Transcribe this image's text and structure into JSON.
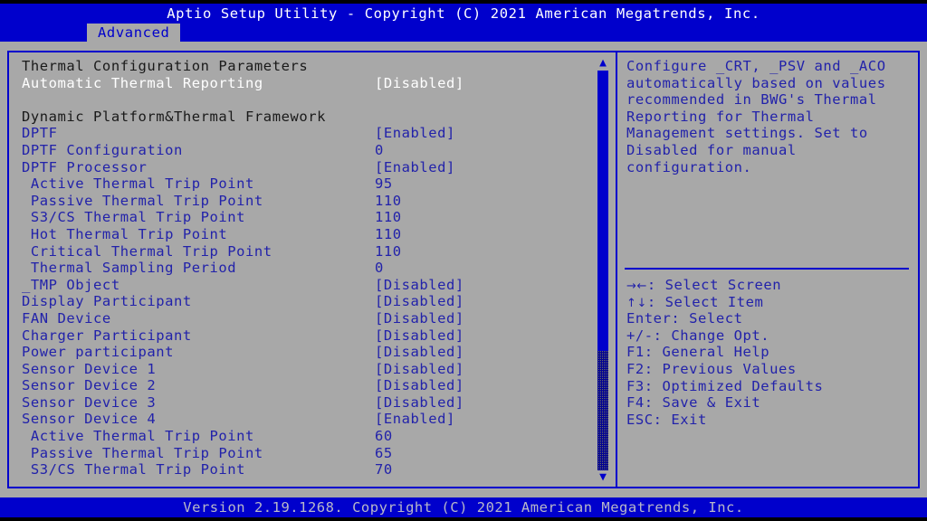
{
  "header": {
    "title": "Aptio Setup Utility - Copyright (C) 2021 American Megatrends, Inc.",
    "active_tab": "Advanced"
  },
  "menu": {
    "rows": [
      {
        "label": "Thermal Configuration Parameters",
        "value": "",
        "style": "head"
      },
      {
        "label": "Automatic Thermal Reporting",
        "value": "[Disabled]",
        "style": "dim"
      },
      {
        "label": "",
        "value": "",
        "style": "blank"
      },
      {
        "label": "Dynamic Platform&Thermal Framework",
        "value": "",
        "style": "head"
      },
      {
        "label": "DPTF",
        "value": "[Enabled]",
        "style": "opt"
      },
      {
        "label": "DPTF Configuration",
        "value": "0",
        "style": "opt"
      },
      {
        "label": "DPTF Processor",
        "value": "[Enabled]",
        "style": "opt"
      },
      {
        "label": " Active Thermal Trip Point",
        "value": "95",
        "style": "opt"
      },
      {
        "label": " Passive Thermal Trip Point",
        "value": "110",
        "style": "opt"
      },
      {
        "label": " S3/CS Thermal Trip Point",
        "value": "110",
        "style": "opt"
      },
      {
        "label": " Hot Thermal Trip Point",
        "value": "110",
        "style": "opt"
      },
      {
        "label": " Critical Thermal Trip Point",
        "value": "110",
        "style": "opt"
      },
      {
        "label": " Thermal Sampling Period",
        "value": "0",
        "style": "opt"
      },
      {
        "label": "_TMP Object",
        "value": "[Disabled]",
        "style": "opt"
      },
      {
        "label": "Display Participant",
        "value": "[Disabled]",
        "style": "opt"
      },
      {
        "label": "FAN Device",
        "value": "[Disabled]",
        "style": "opt"
      },
      {
        "label": "Charger Participant",
        "value": "[Disabled]",
        "style": "opt"
      },
      {
        "label": "Power participant",
        "value": "[Disabled]",
        "style": "opt"
      },
      {
        "label": "Sensor Device 1",
        "value": "[Disabled]",
        "style": "opt"
      },
      {
        "label": "Sensor Device 2",
        "value": "[Disabled]",
        "style": "opt"
      },
      {
        "label": "Sensor Device 3",
        "value": "[Disabled]",
        "style": "opt"
      },
      {
        "label": "Sensor Device 4",
        "value": "[Enabled]",
        "style": "opt"
      },
      {
        "label": " Active Thermal Trip Point",
        "value": "60",
        "style": "opt"
      },
      {
        "label": " Passive Thermal Trip Point",
        "value": "65",
        "style": "opt"
      },
      {
        "label": " S3/CS Thermal Trip Point",
        "value": "70",
        "style": "opt"
      }
    ]
  },
  "scrollbar": {
    "up_arrow": "▲",
    "down_arrow": "▼"
  },
  "help": {
    "description_lines": [
      "Configure _CRT, _PSV and _ACO",
      "automatically based on values",
      "recommended in BWG's Thermal",
      "Reporting for Thermal",
      "Management settings. Set to",
      "Disabled for manual",
      "configuration."
    ],
    "keys": [
      {
        "glyph": "→←",
        "text": ": Select Screen"
      },
      {
        "glyph": "↑↓",
        "text": ": Select Item"
      },
      {
        "glyph": "",
        "text": "Enter: Select"
      },
      {
        "glyph": "",
        "text": "+/-: Change Opt."
      },
      {
        "glyph": "",
        "text": "F1: General Help"
      },
      {
        "glyph": "",
        "text": "F2: Previous Values"
      },
      {
        "glyph": "",
        "text": "F3: Optimized Defaults"
      },
      {
        "glyph": "",
        "text": "F4: Save & Exit"
      },
      {
        "glyph": "",
        "text": "ESC: Exit"
      }
    ]
  },
  "footer": {
    "text": "Version 2.19.1268. Copyright (C) 2021 American Megatrends, Inc."
  },
  "colors": {
    "background": "#a8a8a8",
    "accent_blue": "#0000cc",
    "option_text": "#2222aa",
    "heading_text": "#1a1a1a",
    "disabled_text": "#ffffff",
    "footer_text": "#b8b8c8"
  }
}
